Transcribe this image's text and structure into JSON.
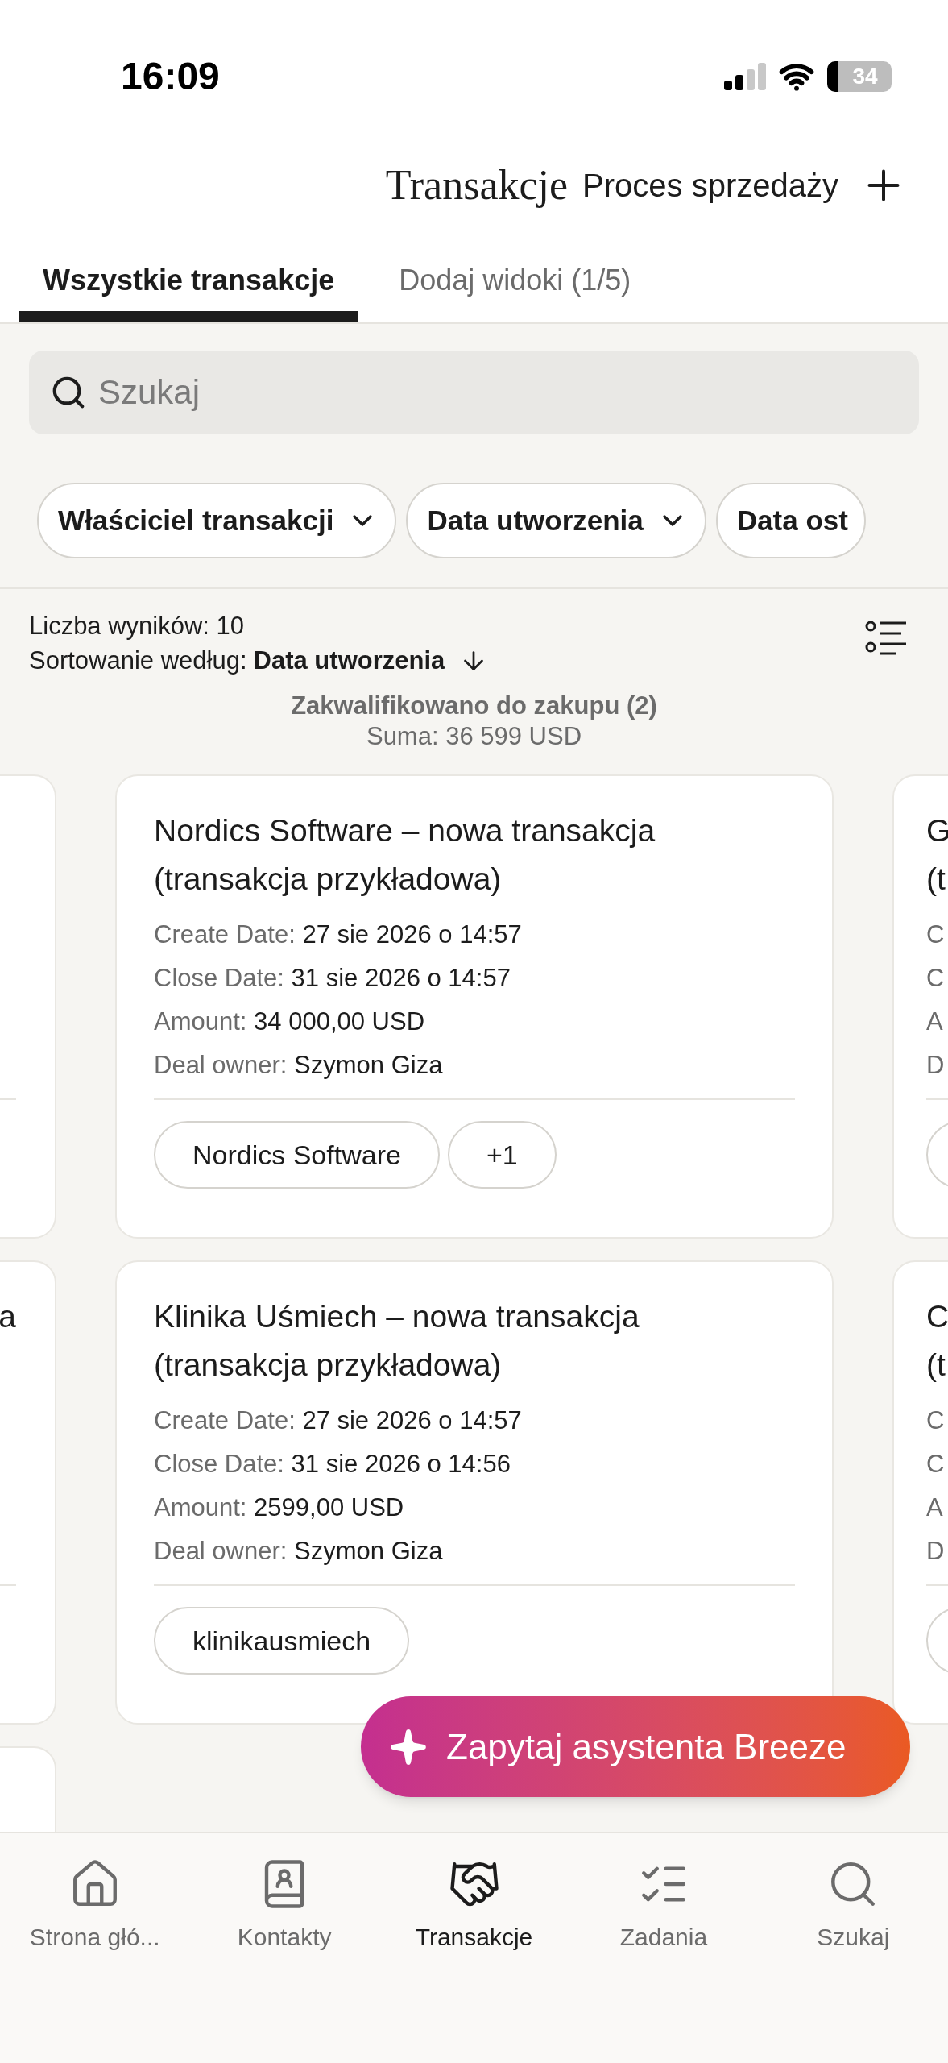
{
  "status_bar": {
    "time": "16:09",
    "battery": "34"
  },
  "header": {
    "title": "Transakcje",
    "pipeline": "Proces sprzedaży"
  },
  "tabs": [
    {
      "label": "Wszystkie transakcje",
      "selected": true
    },
    {
      "label": "Dodaj widoki (1/5)",
      "selected": false
    }
  ],
  "search": {
    "placeholder": "Szukaj"
  },
  "filters": [
    {
      "label": "Właściciel transakcji",
      "kind": "dropdown"
    },
    {
      "label": "Data utworzenia",
      "kind": "dropdown"
    },
    {
      "label": "Data ost",
      "kind": "partial"
    }
  ],
  "results": {
    "count": "Liczba wyników: 10",
    "sort_label": "Sortowanie według:",
    "sort_field": "Data utworzenia"
  },
  "stage": {
    "name": "Zakwalifikowano do zakupu (2)",
    "total": "Suma: 36 599 USD"
  },
  "rows": [
    {
      "cards": [
        {
          "kind": "peek"
        },
        {
          "kind": "deal",
          "title": "Nordics Software – nowa transakcja (transakcja przykładowa)",
          "fields": [
            {
              "label": "Create Date:",
              "value": "27 sie 2026 o 14:57"
            },
            {
              "label": "Close Date:",
              "value": "31 sie 2026 o 14:57"
            },
            {
              "label": "Amount:",
              "value": "34 000,00 USD"
            },
            {
              "label": "Deal owner:",
              "value": "Szymon Giza"
            }
          ],
          "tags": [
            "Nordics Software",
            "+1"
          ]
        },
        {
          "kind": "peek",
          "title_lines": [
            "G",
            "(t"
          ],
          "field_lines": [
            "C",
            "C",
            "A",
            "D"
          ]
        }
      ]
    },
    {
      "cards": [
        {
          "kind": "peek",
          "title_lines": [
            "a"
          ]
        },
        {
          "kind": "deal",
          "title": "Klinika Uśmiech – nowa transakcja (transakcja przykładowa)",
          "fields": [
            {
              "label": "Create Date:",
              "value": "27 sie 2026 o 14:57"
            },
            {
              "label": "Close Date:",
              "value": "31 sie 2026 o 14:56"
            },
            {
              "label": "Amount:",
              "value": "2599,00 USD"
            },
            {
              "label": "Deal owner:",
              "value": "Szymon Giza"
            }
          ],
          "tags": [
            "klinikausmiech"
          ]
        },
        {
          "kind": "peek",
          "title_lines": [
            "C",
            "(t"
          ],
          "field_lines": [
            "C",
            "C",
            "A",
            "D"
          ]
        }
      ]
    },
    {
      "cards": [
        {
          "kind": "peek"
        }
      ]
    }
  ],
  "assistant_button": {
    "label": "Zapytaj asystenta Breeze"
  },
  "nav": [
    {
      "label": "Strona głó...",
      "selected": false
    },
    {
      "label": "Kontakty",
      "selected": false
    },
    {
      "label": "Transakcje",
      "selected": true
    },
    {
      "label": "Zadania",
      "selected": false
    },
    {
      "label": "Szukaj",
      "selected": false
    }
  ]
}
